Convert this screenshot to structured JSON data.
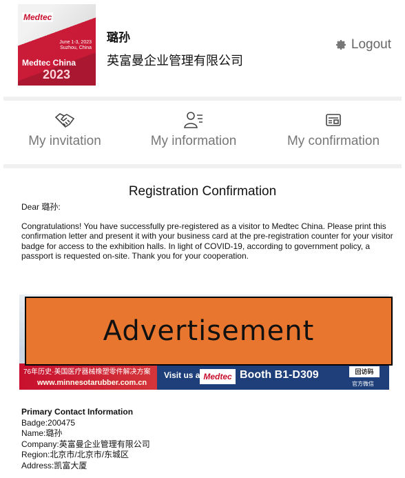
{
  "header": {
    "logo": {
      "brand": "Medtec",
      "dates_line1": "June 1-3, 2023",
      "dates_line2": "Suzhou, China",
      "name": "Medtec China",
      "year": "2023"
    },
    "user_name": "璐孙",
    "company": "英富曼企业管理有限公司",
    "logout_label": "Logout",
    "logout_icon": "gear-icon"
  },
  "tabs": [
    {
      "label": "My invitation",
      "icon": "handshake-icon"
    },
    {
      "label": "My information",
      "icon": "user-list-icon"
    },
    {
      "label": "My confirmation",
      "icon": "confirmation-card-icon"
    }
  ],
  "letter": {
    "title": "Registration Confirmation",
    "greeting": "Dear 璐孙:",
    "body": "Congratulations! You have successfully pre-registered as a visitor to Medtec China. Please print this confirmation letter and present it with your business card at the pre-registration counter for your visitor badge for access to the exhibition halls. In light of COVID-19, according to government policy, a passport is requested on-site. Thank you for your cooperation."
  },
  "banner": {
    "slogan": "76年历史·美国医疗器械橡塑零件解决方案",
    "url": "www.minnesotarubber.com.cn",
    "visit": "Visit us at",
    "medtec": "Medtec",
    "booth": "Booth B1-D309",
    "qr_text": "回访码",
    "wechat": "官方微信"
  },
  "ad_overlay": "Advertisement",
  "contact": {
    "heading": "Primary Contact Information",
    "badge": "Badge:200475",
    "name": "Name:璐孙",
    "company": "Company:英富曼企业管理有限公司",
    "region": "Region:北京市/北京市/东城区",
    "address": "Address:凯富大厦"
  }
}
